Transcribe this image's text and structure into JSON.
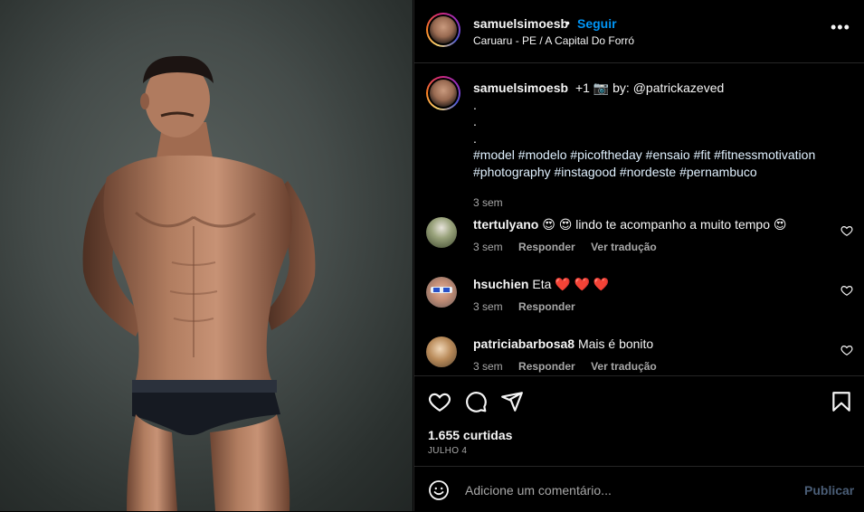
{
  "post": {
    "username": "samuelsimoesb",
    "follow_label": "Seguir",
    "location": "Caruaru - PE / A Capital Do Forró",
    "separator": "•",
    "more_icon": "more-horizontal-icon"
  },
  "caption": {
    "username": "samuelsimoesb",
    "lines": [
      "+1 📷 by: @patrickazeved",
      ".",
      ".",
      ".",
      "#model #modelo #picoftheday #ensaio #fit #fitnessmotivation",
      "#photography #instagood #nordeste #pernambuco"
    ],
    "time": "3 sem"
  },
  "comments": [
    {
      "username": "ttertulyano",
      "text": "😍 😍  lindo te acompanho a muito tempo 😍",
      "time": "3 sem",
      "reply": "Responder",
      "translate": "Ver tradução"
    },
    {
      "username": "hsuchien",
      "text": "Eta ❤️ ❤️ ❤️",
      "time": "3 sem",
      "reply": "Responder",
      "translate": ""
    },
    {
      "username": "patriciabarbosa8",
      "text": "Mais é bonito",
      "time": "3 sem",
      "reply": "Responder",
      "translate": "Ver tradução"
    }
  ],
  "actions": {
    "likes": "1.655 curtidas",
    "date": "JULHO 4",
    "icons": [
      "heart-icon",
      "comment-icon",
      "share-icon",
      "bookmark-icon"
    ]
  },
  "add_comment": {
    "placeholder": "Adicione um comentário...",
    "publish_label": "Publicar"
  },
  "colors": {
    "background": "#000000",
    "link_blue": "#0095f6",
    "secondary_text": "#a8a8a8",
    "publish_disabled": "#4a5d76",
    "divider": "#262626"
  }
}
